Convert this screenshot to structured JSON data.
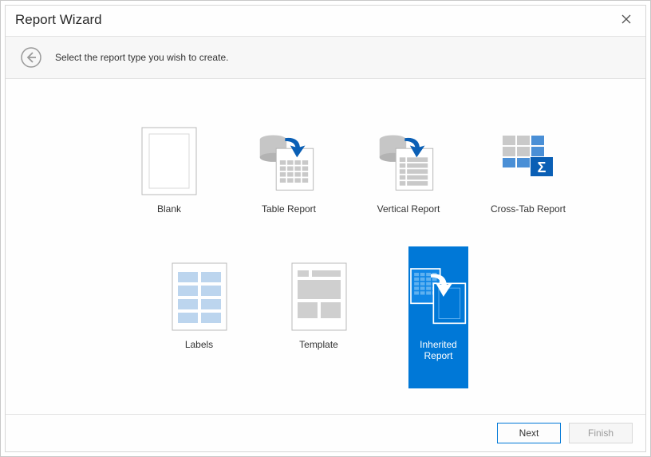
{
  "window": {
    "title": "Report Wizard",
    "instruction": "Select the report type you wish to create."
  },
  "tiles": {
    "blank": "Blank",
    "table": "Table Report",
    "vertical": "Vertical Report",
    "crosstab": "Cross-Tab Report",
    "labels": "Labels",
    "template": "Template",
    "inherited": "Inherited Report"
  },
  "selected": "inherited",
  "footer": {
    "next": "Next",
    "finish": "Finish"
  },
  "colors": {
    "accent": "#0078d7",
    "icon_grey": "#bfbfbf",
    "icon_outline": "#a7a7a7"
  }
}
